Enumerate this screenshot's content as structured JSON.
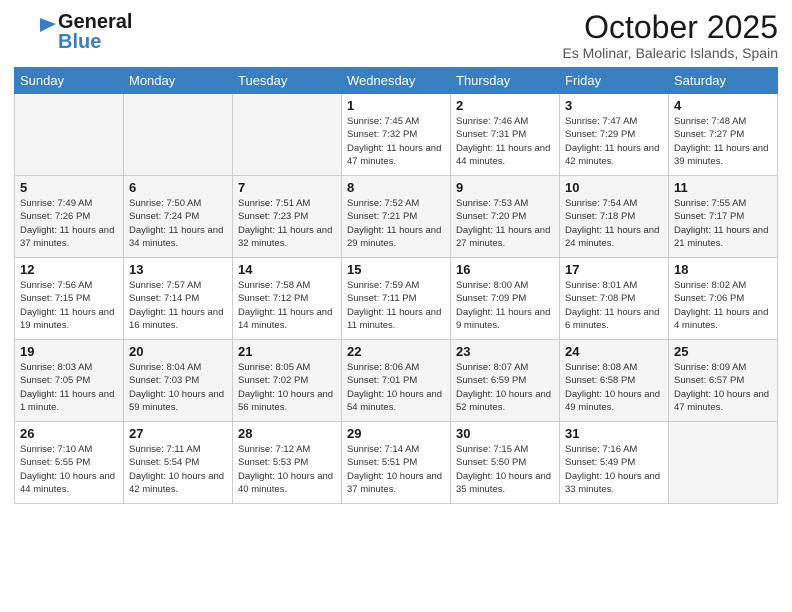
{
  "header": {
    "logo_general": "General",
    "logo_blue": "Blue",
    "month": "October 2025",
    "location": "Es Molinar, Balearic Islands, Spain"
  },
  "weekdays": [
    "Sunday",
    "Monday",
    "Tuesday",
    "Wednesday",
    "Thursday",
    "Friday",
    "Saturday"
  ],
  "weeks": [
    [
      {
        "day": "",
        "info": ""
      },
      {
        "day": "",
        "info": ""
      },
      {
        "day": "",
        "info": ""
      },
      {
        "day": "1",
        "info": "Sunrise: 7:45 AM\nSunset: 7:32 PM\nDaylight: 11 hours\nand 47 minutes."
      },
      {
        "day": "2",
        "info": "Sunrise: 7:46 AM\nSunset: 7:31 PM\nDaylight: 11 hours\nand 44 minutes."
      },
      {
        "day": "3",
        "info": "Sunrise: 7:47 AM\nSunset: 7:29 PM\nDaylight: 11 hours\nand 42 minutes."
      },
      {
        "day": "4",
        "info": "Sunrise: 7:48 AM\nSunset: 7:27 PM\nDaylight: 11 hours\nand 39 minutes."
      }
    ],
    [
      {
        "day": "5",
        "info": "Sunrise: 7:49 AM\nSunset: 7:26 PM\nDaylight: 11 hours\nand 37 minutes."
      },
      {
        "day": "6",
        "info": "Sunrise: 7:50 AM\nSunset: 7:24 PM\nDaylight: 11 hours\nand 34 minutes."
      },
      {
        "day": "7",
        "info": "Sunrise: 7:51 AM\nSunset: 7:23 PM\nDaylight: 11 hours\nand 32 minutes."
      },
      {
        "day": "8",
        "info": "Sunrise: 7:52 AM\nSunset: 7:21 PM\nDaylight: 11 hours\nand 29 minutes."
      },
      {
        "day": "9",
        "info": "Sunrise: 7:53 AM\nSunset: 7:20 PM\nDaylight: 11 hours\nand 27 minutes."
      },
      {
        "day": "10",
        "info": "Sunrise: 7:54 AM\nSunset: 7:18 PM\nDaylight: 11 hours\nand 24 minutes."
      },
      {
        "day": "11",
        "info": "Sunrise: 7:55 AM\nSunset: 7:17 PM\nDaylight: 11 hours\nand 21 minutes."
      }
    ],
    [
      {
        "day": "12",
        "info": "Sunrise: 7:56 AM\nSunset: 7:15 PM\nDaylight: 11 hours\nand 19 minutes."
      },
      {
        "day": "13",
        "info": "Sunrise: 7:57 AM\nSunset: 7:14 PM\nDaylight: 11 hours\nand 16 minutes."
      },
      {
        "day": "14",
        "info": "Sunrise: 7:58 AM\nSunset: 7:12 PM\nDaylight: 11 hours\nand 14 minutes."
      },
      {
        "day": "15",
        "info": "Sunrise: 7:59 AM\nSunset: 7:11 PM\nDaylight: 11 hours\nand 11 minutes."
      },
      {
        "day": "16",
        "info": "Sunrise: 8:00 AM\nSunset: 7:09 PM\nDaylight: 11 hours\nand 9 minutes."
      },
      {
        "day": "17",
        "info": "Sunrise: 8:01 AM\nSunset: 7:08 PM\nDaylight: 11 hours\nand 6 minutes."
      },
      {
        "day": "18",
        "info": "Sunrise: 8:02 AM\nSunset: 7:06 PM\nDaylight: 11 hours\nand 4 minutes."
      }
    ],
    [
      {
        "day": "19",
        "info": "Sunrise: 8:03 AM\nSunset: 7:05 PM\nDaylight: 11 hours\nand 1 minute."
      },
      {
        "day": "20",
        "info": "Sunrise: 8:04 AM\nSunset: 7:03 PM\nDaylight: 10 hours\nand 59 minutes."
      },
      {
        "day": "21",
        "info": "Sunrise: 8:05 AM\nSunset: 7:02 PM\nDaylight: 10 hours\nand 56 minutes."
      },
      {
        "day": "22",
        "info": "Sunrise: 8:06 AM\nSunset: 7:01 PM\nDaylight: 10 hours\nand 54 minutes."
      },
      {
        "day": "23",
        "info": "Sunrise: 8:07 AM\nSunset: 6:59 PM\nDaylight: 10 hours\nand 52 minutes."
      },
      {
        "day": "24",
        "info": "Sunrise: 8:08 AM\nSunset: 6:58 PM\nDaylight: 10 hours\nand 49 minutes."
      },
      {
        "day": "25",
        "info": "Sunrise: 8:09 AM\nSunset: 6:57 PM\nDaylight: 10 hours\nand 47 minutes."
      }
    ],
    [
      {
        "day": "26",
        "info": "Sunrise: 7:10 AM\nSunset: 5:55 PM\nDaylight: 10 hours\nand 44 minutes."
      },
      {
        "day": "27",
        "info": "Sunrise: 7:11 AM\nSunset: 5:54 PM\nDaylight: 10 hours\nand 42 minutes."
      },
      {
        "day": "28",
        "info": "Sunrise: 7:12 AM\nSunset: 5:53 PM\nDaylight: 10 hours\nand 40 minutes."
      },
      {
        "day": "29",
        "info": "Sunrise: 7:14 AM\nSunset: 5:51 PM\nDaylight: 10 hours\nand 37 minutes."
      },
      {
        "day": "30",
        "info": "Sunrise: 7:15 AM\nSunset: 5:50 PM\nDaylight: 10 hours\nand 35 minutes."
      },
      {
        "day": "31",
        "info": "Sunrise: 7:16 AM\nSunset: 5:49 PM\nDaylight: 10 hours\nand 33 minutes."
      },
      {
        "day": "",
        "info": ""
      }
    ]
  ]
}
